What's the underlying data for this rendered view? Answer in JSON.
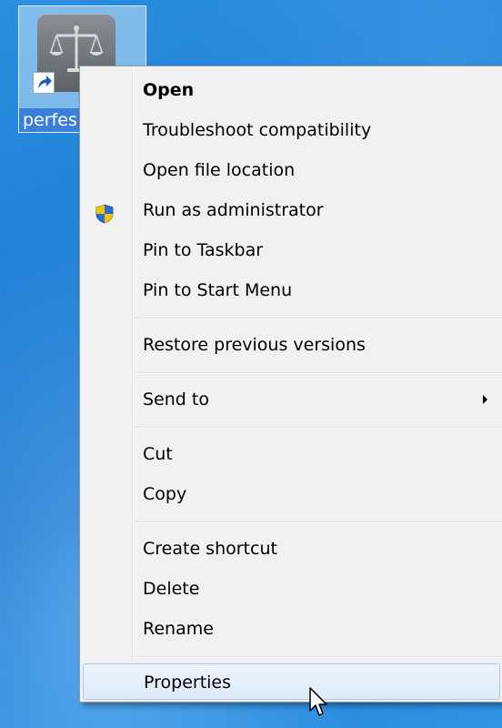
{
  "desktop": {
    "icon_label": "perfes",
    "icon_name": "scales-of-justice-icon",
    "overlay": "shortcut-arrow-icon"
  },
  "context_menu": {
    "items": [
      {
        "label": "Open",
        "bold": true
      },
      {
        "label": "Troubleshoot compatibility"
      },
      {
        "label": "Open file location"
      },
      {
        "label": "Run as administrator",
        "icon": "uac-shield-icon"
      },
      {
        "label": "Pin to Taskbar"
      },
      {
        "label": "Pin to Start Menu"
      },
      {
        "label": "Restore previous versions"
      },
      {
        "label": "Send to",
        "submenu": true
      },
      {
        "label": "Cut"
      },
      {
        "label": "Copy"
      },
      {
        "label": "Create shortcut"
      },
      {
        "label": "Delete"
      },
      {
        "label": "Rename"
      },
      {
        "label": "Properties",
        "highlighted": true
      }
    ]
  },
  "colors": {
    "desktop_blue": "#1f7fd6",
    "menu_background": "#f1f1f1",
    "highlight_border": "#a8c8ec"
  }
}
